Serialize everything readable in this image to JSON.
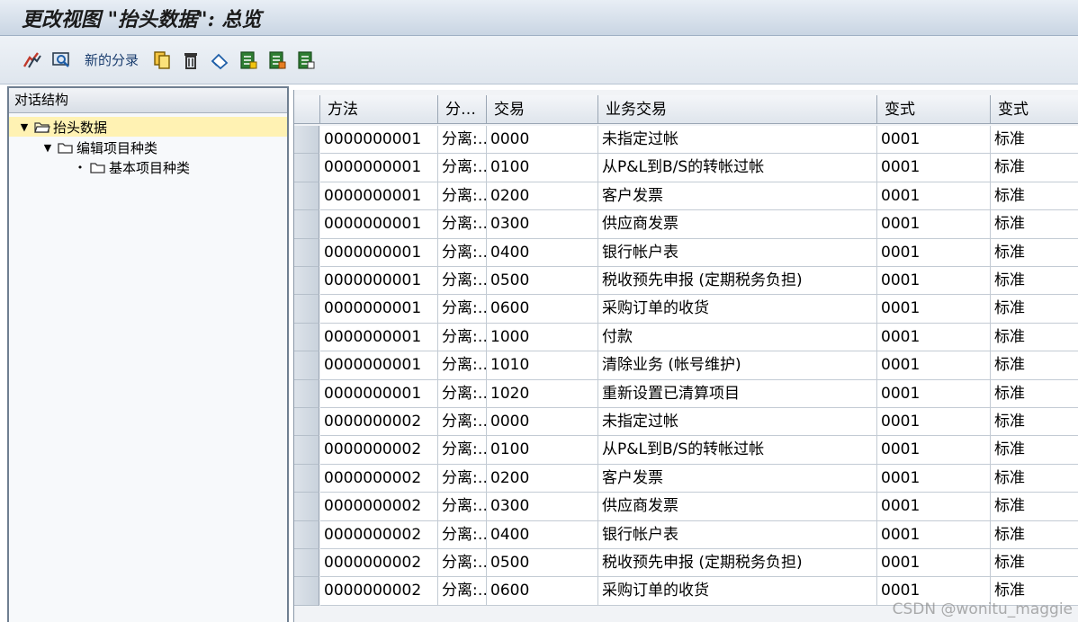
{
  "window": {
    "title": "更改视图 \"抬头数据\": 总览"
  },
  "toolbar": {
    "new_entries_label": "新的分录",
    "icons": [
      "edit-icon",
      "display-change-icon",
      "copy-icon",
      "delete-icon",
      "undo-icon",
      "select-all-icon",
      "select-block-icon",
      "deselect-all-icon"
    ]
  },
  "dialog_structure": {
    "header": "对话结构",
    "nodes": [
      {
        "label": "抬头数据",
        "level": 0,
        "selected": true
      },
      {
        "label": "编辑项目种类",
        "level": 1,
        "selected": false
      },
      {
        "label": "基本项目种类",
        "level": 2,
        "selected": false
      }
    ]
  },
  "table": {
    "columns": [
      "方法",
      "分…",
      "交易",
      "业务交易",
      "变式",
      "变式"
    ],
    "rows": [
      [
        "0000000001",
        "分离:…",
        "0000",
        "未指定过帐",
        "0001",
        "标准"
      ],
      [
        "0000000001",
        "分离:…",
        "0100",
        "从P&L到B/S的转帐过帐",
        "0001",
        "标准"
      ],
      [
        "0000000001",
        "分离:…",
        "0200",
        "客户发票",
        "0001",
        "标准"
      ],
      [
        "0000000001",
        "分离:…",
        "0300",
        "供应商发票",
        "0001",
        "标准"
      ],
      [
        "0000000001",
        "分离:…",
        "0400",
        "银行帐户表",
        "0001",
        "标准"
      ],
      [
        "0000000001",
        "分离:…",
        "0500",
        "税收预先申报 (定期税务负担)",
        "0001",
        "标准"
      ],
      [
        "0000000001",
        "分离:…",
        "0600",
        "采购订单的收货",
        "0001",
        "标准"
      ],
      [
        "0000000001",
        "分离:…",
        "1000",
        "付款",
        "0001",
        "标准"
      ],
      [
        "0000000001",
        "分离:…",
        "1010",
        "清除业务 (帐号维护)",
        "0001",
        "标准"
      ],
      [
        "0000000001",
        "分离:…",
        "1020",
        "重新设置已清算项目",
        "0001",
        "标准"
      ],
      [
        "0000000002",
        "分离:…",
        "0000",
        "未指定过帐",
        "0001",
        "标准"
      ],
      [
        "0000000002",
        "分离:…",
        "0100",
        "从P&L到B/S的转帐过帐",
        "0001",
        "标准"
      ],
      [
        "0000000002",
        "分离:…",
        "0200",
        "客户发票",
        "0001",
        "标准"
      ],
      [
        "0000000002",
        "分离:…",
        "0300",
        "供应商发票",
        "0001",
        "标准"
      ],
      [
        "0000000002",
        "分离:…",
        "0400",
        "银行帐户表",
        "0001",
        "标准"
      ],
      [
        "0000000002",
        "分离:…",
        "0500",
        "税收预先申报 (定期税务负担)",
        "0001",
        "标准"
      ],
      [
        "0000000002",
        "分离:…",
        "0600",
        "采购订单的收货",
        "0001",
        "标准"
      ]
    ]
  },
  "watermark": "CSDN @wonitu_maggie",
  "colors": {
    "selected_node": "#fff2b3",
    "title_bar": "#c9d5e3",
    "border": "#6f7f91"
  }
}
